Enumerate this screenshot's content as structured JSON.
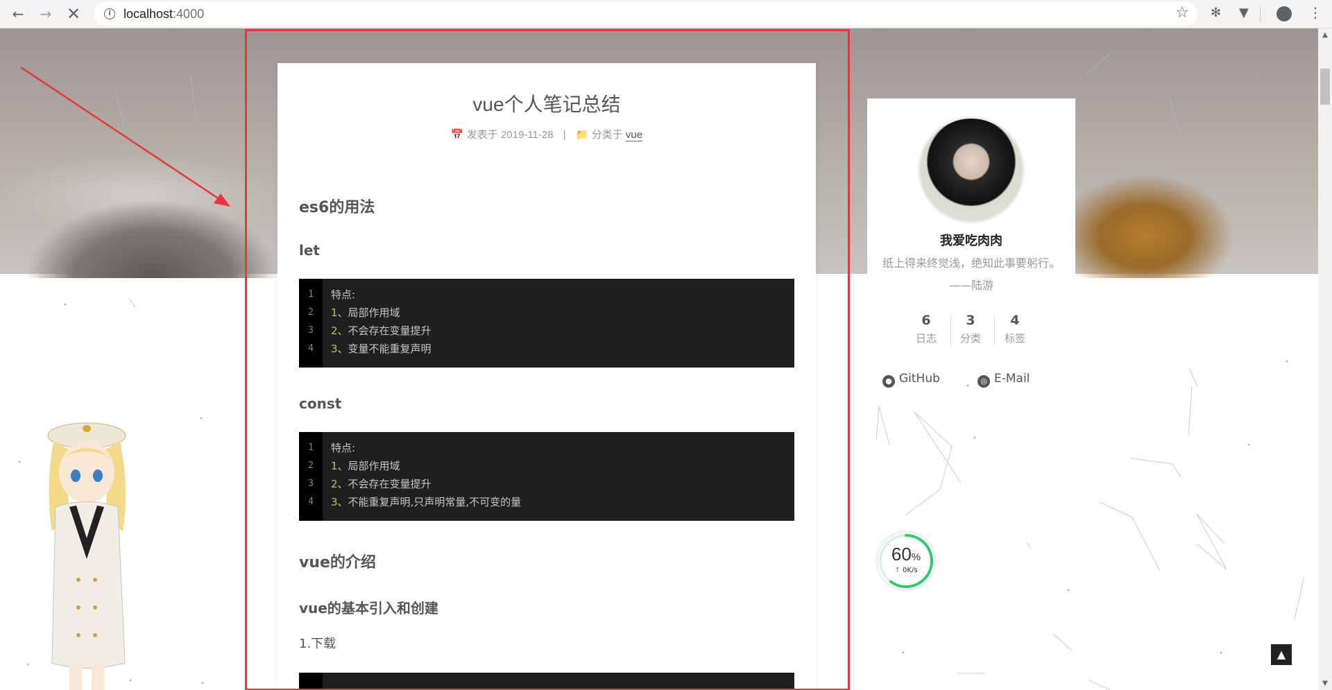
{
  "browser": {
    "url_host": "localhost",
    "url_port": ":4000"
  },
  "post": {
    "title": "vue个人笔记总结",
    "meta_published": "发表于 2019-11-28",
    "meta_divider": "|",
    "meta_category_prefix": "分类于",
    "meta_category": "vue",
    "h_es6": "es6的用法",
    "h_let": "let",
    "let_code": [
      {
        "n": "1",
        "num": "",
        "text": "特点:"
      },
      {
        "n": "2",
        "num": "1",
        "text": "、局部作用域"
      },
      {
        "n": "3",
        "num": "2",
        "text": "、不会存在变量提升"
      },
      {
        "n": "4",
        "num": "3",
        "text": "、变量不能重复声明"
      }
    ],
    "h_const": "const",
    "const_code": [
      {
        "n": "1",
        "num": "",
        "text": "特点:"
      },
      {
        "n": "2",
        "num": "1",
        "text": "、局部作用域"
      },
      {
        "n": "3",
        "num": "2",
        "text": "、不会存在变量提升"
      },
      {
        "n": "4",
        "num": "3",
        "text": "、不能重复声明,只声明常量,不可变的量"
      }
    ],
    "h_vue_intro": "vue的介绍",
    "h_vue_basic": "vue的基本引入和创建",
    "p_download": "1.下载"
  },
  "sidebar": {
    "author": "我爱吃肉肉",
    "motto": "纸上得来终觉浅，绝知此事要躬行。",
    "motto_author": "——陆游",
    "stats": [
      {
        "count": "6",
        "label": "日志"
      },
      {
        "count": "3",
        "label": "分类"
      },
      {
        "count": "4",
        "label": "标签"
      }
    ],
    "links": {
      "github": "GitHub",
      "email": "E-Mail"
    }
  },
  "speed_widget": {
    "percent": "60",
    "percent_sign": "%",
    "rate": "0K/s",
    "progress": 0.6
  },
  "colors": {
    "annotation_red": "#e8363c",
    "code_bg": "#1d1f21",
    "speed_green": "#2ecc71"
  }
}
